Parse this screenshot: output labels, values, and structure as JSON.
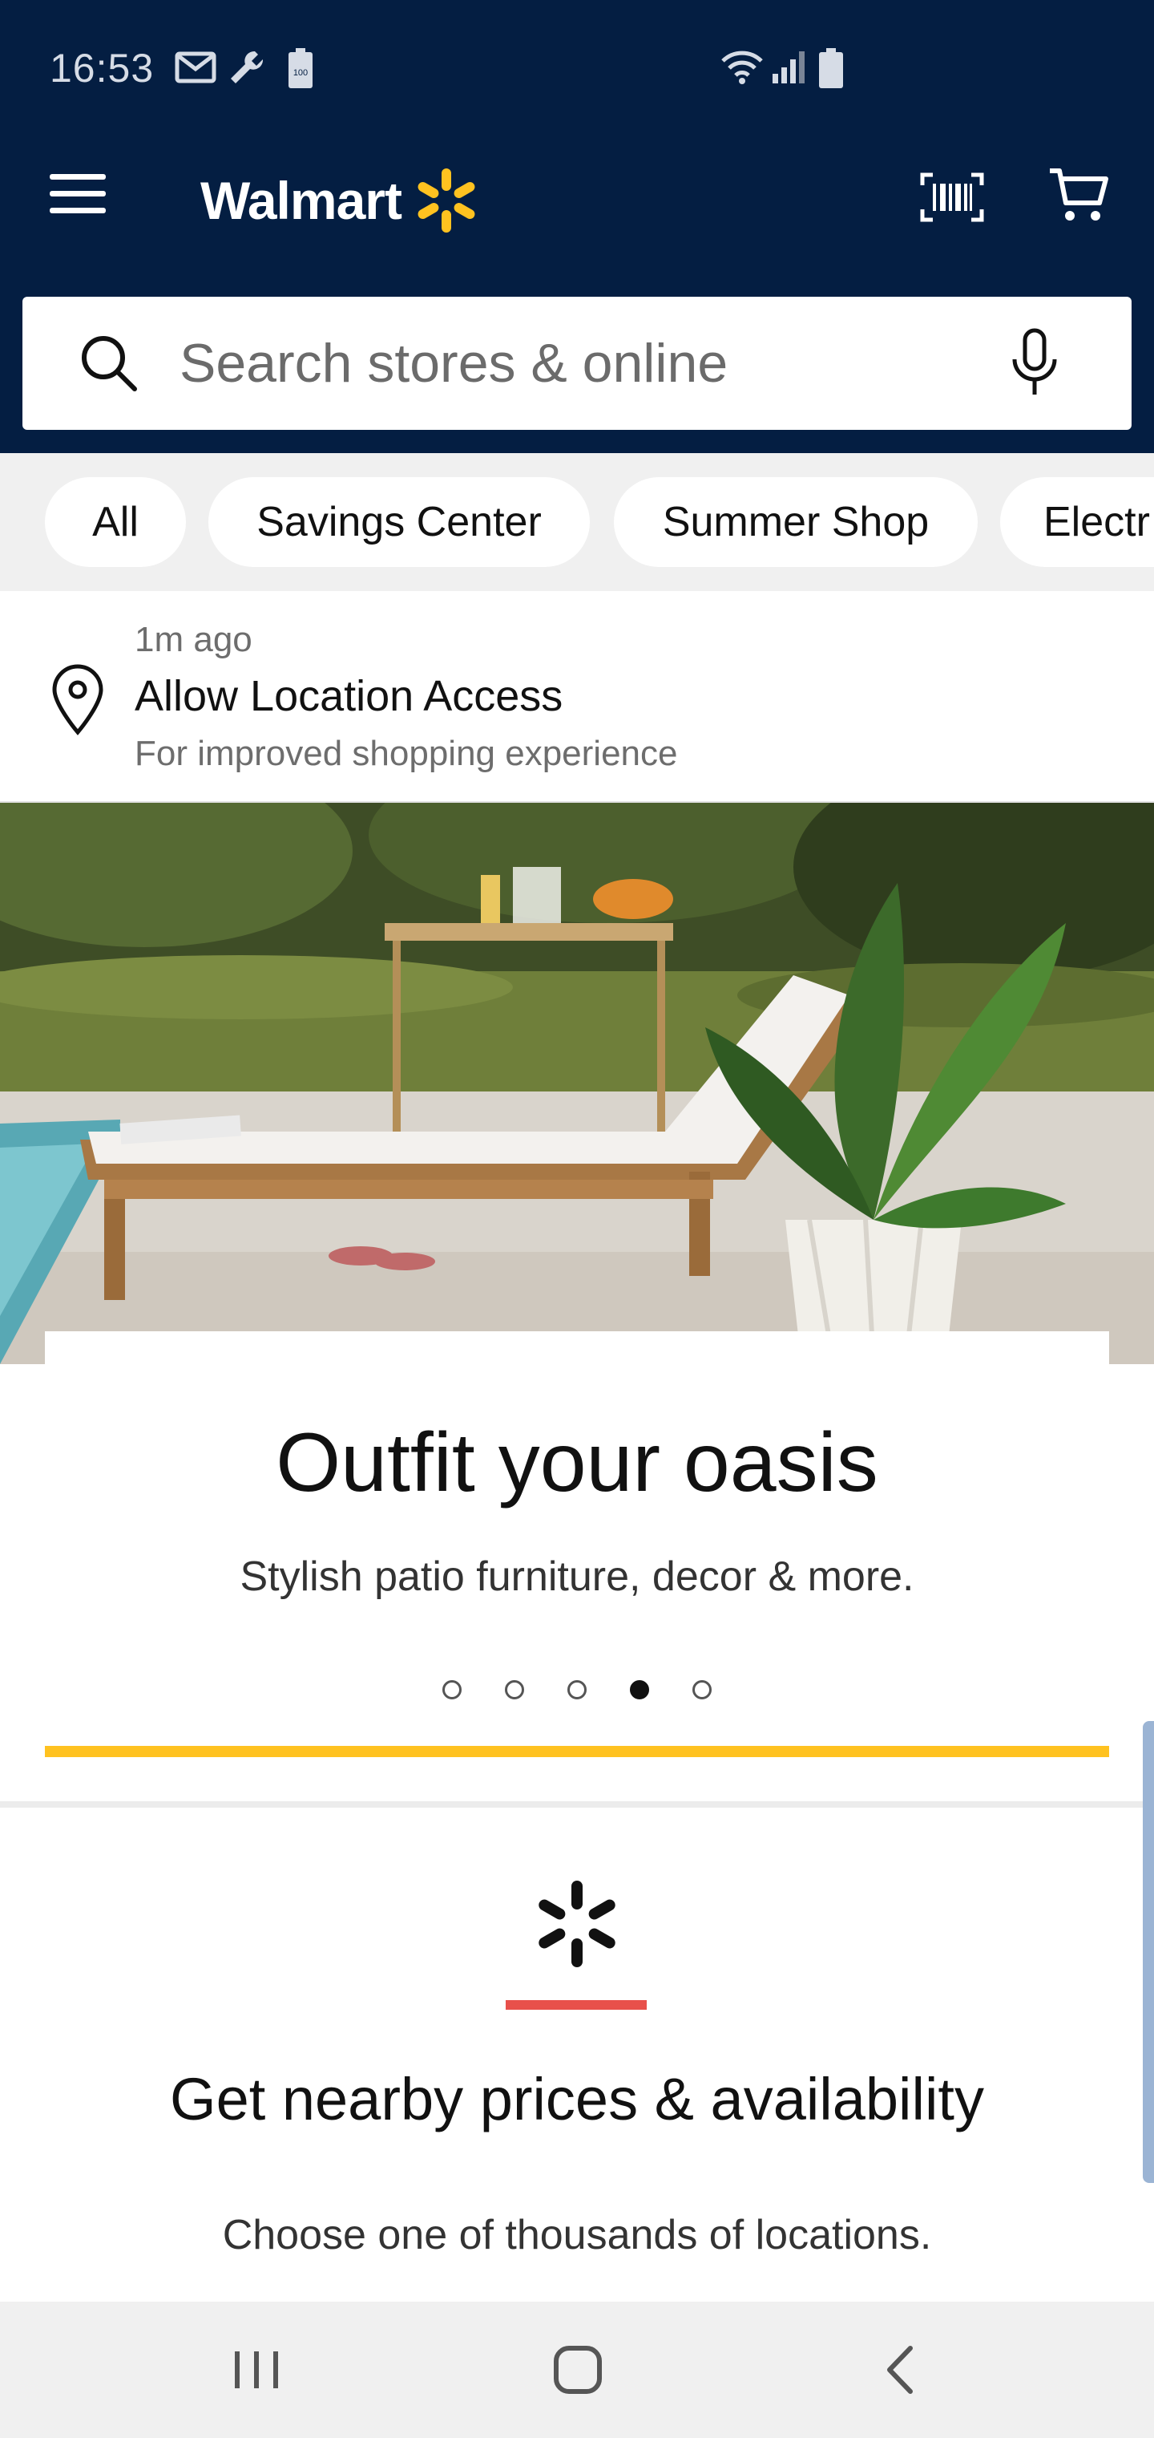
{
  "status_bar": {
    "time": "16:53",
    "left_icons": [
      "gmail-icon",
      "wrench-icon",
      "battery-100-icon"
    ],
    "right_icons": [
      "wifi-icon",
      "signal-icon",
      "battery-icon"
    ]
  },
  "header": {
    "logo_text": "Walmart",
    "brand_colors": {
      "navy": "#041e42",
      "spark": "#ffc220"
    },
    "menu_icon": "hamburger-icon",
    "barcode_icon": "barcode-scanner-icon",
    "cart_icon": "cart-icon"
  },
  "search": {
    "placeholder": "Search stores & online",
    "value": ""
  },
  "chips": [
    {
      "label": "All"
    },
    {
      "label": "Savings Center"
    },
    {
      "label": "Summer Shop"
    },
    {
      "label": "Electr"
    }
  ],
  "location_notice": {
    "time": "1m ago",
    "title": "Allow Location Access",
    "subtitle": "For improved shopping experience"
  },
  "hero": {
    "title": "Outfit your oasis",
    "subtitle": "Stylish patio furniture, decor & more.",
    "carousel_total": 5,
    "carousel_active": 4,
    "accent_color": "#ffc220"
  },
  "nearby": {
    "title": "Get nearby prices & availability",
    "subtitle": "Choose one of thousands of locations.",
    "accent_color": "#e8504b"
  },
  "nav": {
    "recent_icon": "recent-apps-icon",
    "home_icon": "home-icon",
    "back_icon": "back-icon"
  }
}
